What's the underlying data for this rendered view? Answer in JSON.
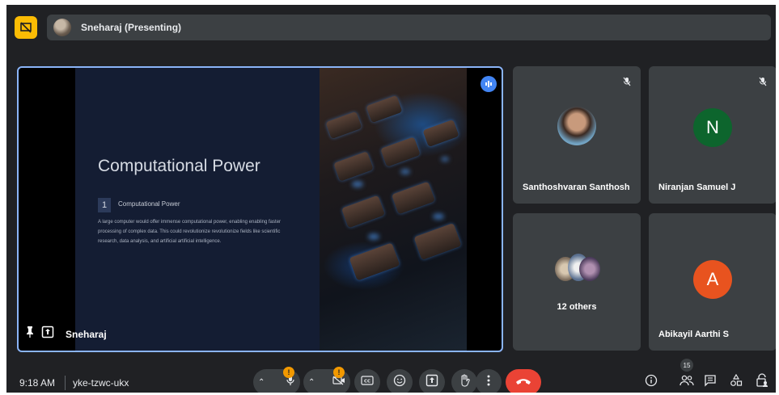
{
  "top_bar": {
    "presenter_label": "Sneharaj (Presenting)"
  },
  "slide": {
    "title": "Computational Power",
    "item_number": "1",
    "item_title": "Computational Power",
    "item_body": "A large computer would offer immense computational power, enabling enabling faster processing of complex data. This could revolutionize revolutionize fields like scientific research, data analysis, and artificial artificial intelligence.",
    "tile_label": "Sneharaj"
  },
  "participants": [
    {
      "name": "Santhoshvaran Santhosh",
      "muted": true,
      "avatar": "photo"
    },
    {
      "name": "Niranjan Samuel J",
      "muted": true,
      "avatar_letter": "N",
      "avatar_color": "#0d652d"
    },
    {
      "name": "12 others",
      "avatar": "group-photos"
    },
    {
      "name": "Abikayil Aarthi S",
      "avatar_letter": "A",
      "avatar_color": "#e8531f"
    }
  ],
  "bottom_bar": {
    "time": "9:18 AM",
    "meeting_code": "yke-tzwc-ukx",
    "mic_badge": "!",
    "camera_badge": "!",
    "participant_count": "15"
  },
  "colors": {
    "background": "#202124",
    "tile": "#3c4043",
    "accent_blue": "#8ab4f8",
    "end_call": "#ea4335",
    "present_yellow": "#fbbc04",
    "warning": "#f29900"
  }
}
